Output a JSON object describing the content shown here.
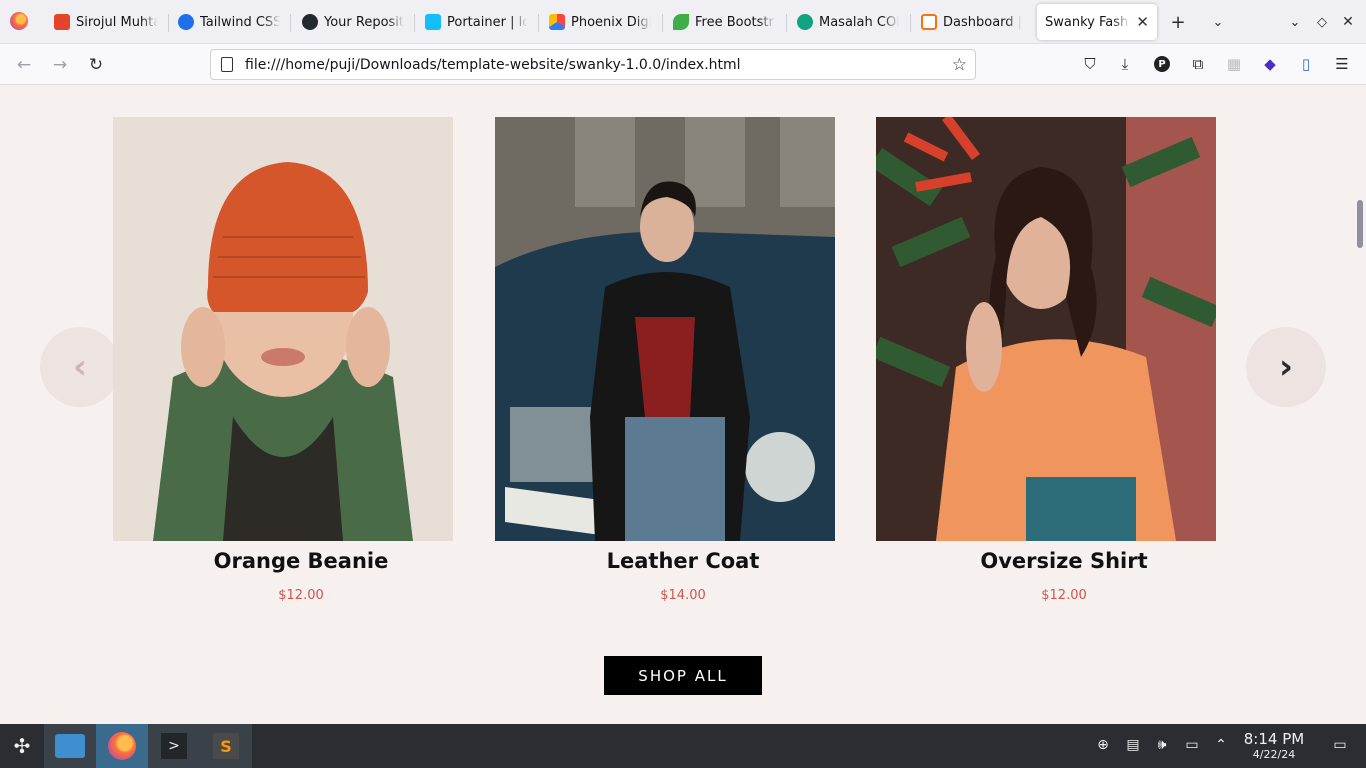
{
  "browser": {
    "tabs": [
      {
        "label": "Sirojul Muhtar",
        "icon": "gitlab-icon",
        "color": "#e24329"
      },
      {
        "label": "Tailwind CSS",
        "icon": "play-icon",
        "color": "#1f6feb"
      },
      {
        "label": "Your Repositories",
        "icon": "github-icon",
        "color": "#24292f"
      },
      {
        "label": "Portainer | lo",
        "icon": "portainer-icon",
        "color": "#13bef9"
      },
      {
        "label": "Phoenix Digital",
        "icon": "phoenix-icon",
        "color": "#2e7cf6"
      },
      {
        "label": "Free Bootstrap",
        "icon": "leaf-icon",
        "color": "#3fae49"
      },
      {
        "label": "Masalah CORS",
        "icon": "chatgpt-icon",
        "color": "#10a37f"
      },
      {
        "label": "Dashboard |",
        "icon": "dashboard-icon",
        "color": "#f97316"
      },
      {
        "label": "Swanky Fashion",
        "icon": "",
        "color": ""
      }
    ],
    "url": "file:///home/puji/Downloads/template-website/swanky-1.0.0/index.html"
  },
  "products": [
    {
      "name": "Orange Beanie",
      "price": "$12.00"
    },
    {
      "name": "Leather Coat",
      "price": "$14.00"
    },
    {
      "name": "Oversize Shirt",
      "price": "$12.00"
    }
  ],
  "carousel": {
    "prev": "‹",
    "next": "›"
  },
  "shop_button": "SHOP ALL",
  "taskbar": {
    "time": "8:14 PM",
    "date": "4/22/24"
  },
  "colors": {
    "price": "#d2554a",
    "page_bg": "#f6f0ee",
    "button_bg": "#000000"
  }
}
